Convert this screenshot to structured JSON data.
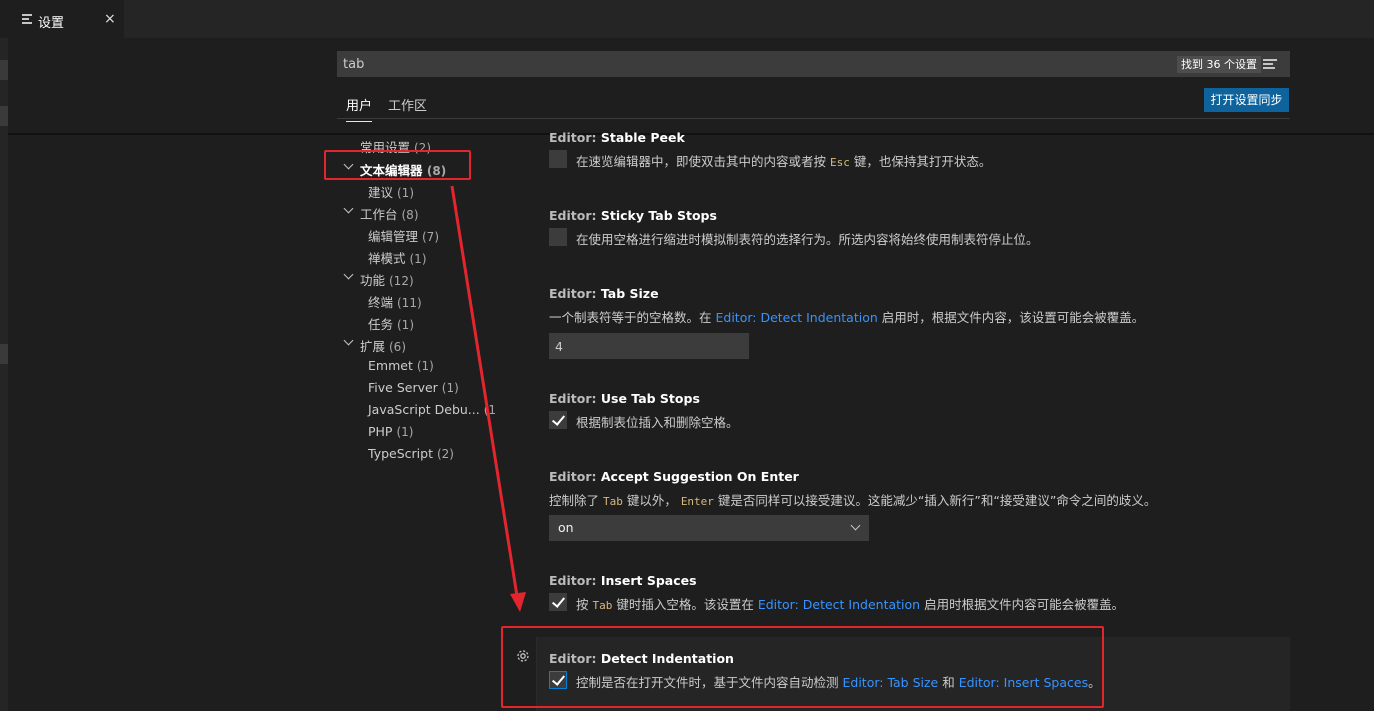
{
  "tab": {
    "title": "设置",
    "close": "×"
  },
  "search": {
    "value": "tab",
    "result_count": "找到 36 个设置"
  },
  "scope_tabs": {
    "user": "用户",
    "workspace": "工作区"
  },
  "sync_button": "打开设置同步",
  "toc": {
    "common": {
      "label": "常用设置",
      "count": "(2)"
    },
    "text_editor": {
      "label": "文本编辑器",
      "count": "(8)"
    },
    "suggestions": {
      "label": "建议",
      "count": "(1)"
    },
    "workbench": {
      "label": "工作台",
      "count": "(8)"
    },
    "editor_management": {
      "label": "编辑管理",
      "count": "(7)"
    },
    "zen_mode": {
      "label": "禅模式",
      "count": "(1)"
    },
    "features": {
      "label": "功能",
      "count": "(12)"
    },
    "terminal": {
      "label": "终端",
      "count": "(11)"
    },
    "tasks": {
      "label": "任务",
      "count": "(1)"
    },
    "extensions": {
      "label": "扩展",
      "count": "(6)"
    },
    "emmet": {
      "label": "Emmet",
      "count": "(1)"
    },
    "five_server": {
      "label": "Five Server",
      "count": "(1)"
    },
    "js_debugger": {
      "label": "JavaScript Debu...",
      "count": "(1"
    },
    "php": {
      "label": "PHP",
      "count": "(1)"
    },
    "typescript": {
      "label": "TypeScript",
      "count": "(2)"
    }
  },
  "settings": {
    "stable_peek": {
      "prefix": "Editor: ",
      "name": "Stable Peek",
      "desc_a": "在速览编辑器中，即使双击其中的内容或者按 ",
      "code": "Esc",
      "desc_b": " 键，也保持其打开状态。",
      "checked": false
    },
    "sticky_tab_stops": {
      "prefix": "Editor: ",
      "name": "Sticky Tab Stops",
      "desc": "在使用空格进行缩进时模拟制表符的选择行为。所选内容将始终使用制表符停止位。",
      "checked": false
    },
    "tab_size": {
      "prefix": "Editor: ",
      "name": "Tab Size",
      "desc_a": "一个制表符等于的空格数。在 ",
      "link": "Editor: Detect Indentation",
      "desc_b": " 启用时，根据文件内容，该设置可能会被覆盖。",
      "value": "4"
    },
    "use_tab_stops": {
      "prefix": "Editor: ",
      "name": "Use Tab Stops",
      "desc": "根据制表位插入和删除空格。",
      "checked": true
    },
    "accept_suggestion": {
      "prefix": "Editor: ",
      "name": "Accept Suggestion On Enter",
      "desc_a": "控制除了 ",
      "code1": "Tab",
      "desc_b": " 键以外， ",
      "code2": "Enter",
      "desc_c": " 键是否同样可以接受建议。这能减少“插入新行”和“接受建议”命令之间的歧义。",
      "value": "on"
    },
    "insert_spaces": {
      "prefix": "Editor: ",
      "name": "Insert Spaces",
      "desc_a": "按 ",
      "code": "Tab",
      "desc_b": " 键时插入空格。该设置在 ",
      "link": "Editor: Detect Indentation",
      "desc_c": " 启用时根据文件内容可能会被覆盖。",
      "checked": true
    },
    "detect_indentation": {
      "prefix": "Editor: ",
      "name": "Detect Indentation",
      "desc_a": "控制是否在打开文件时，基于文件内容自动检测 ",
      "link1": "Editor: Tab Size",
      "desc_b": " 和 ",
      "link2": "Editor: Insert Spaces",
      "desc_c": "。",
      "checked": true
    }
  },
  "colors": {
    "annotation": "#e3252d",
    "link": "#3794ff",
    "primary_button": "#0e639c"
  }
}
